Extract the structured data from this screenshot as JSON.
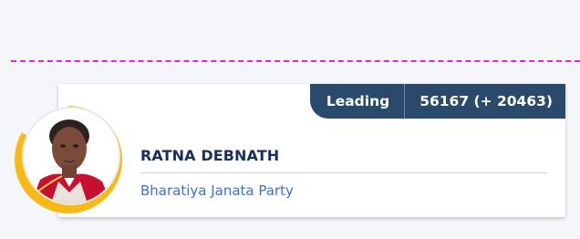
{
  "result": {
    "status_label": "Leading",
    "votes_text": "56167 (+ 20463)"
  },
  "candidate": {
    "name": "RATNA DEBNATH",
    "party": "Bharatiya Janata Party"
  },
  "colors": {
    "status_bg": "#2a4a6b",
    "ring": "#f8b912",
    "name": "#1a2f5e",
    "party": "#3d6fd6",
    "divider": "#e61ee6"
  }
}
